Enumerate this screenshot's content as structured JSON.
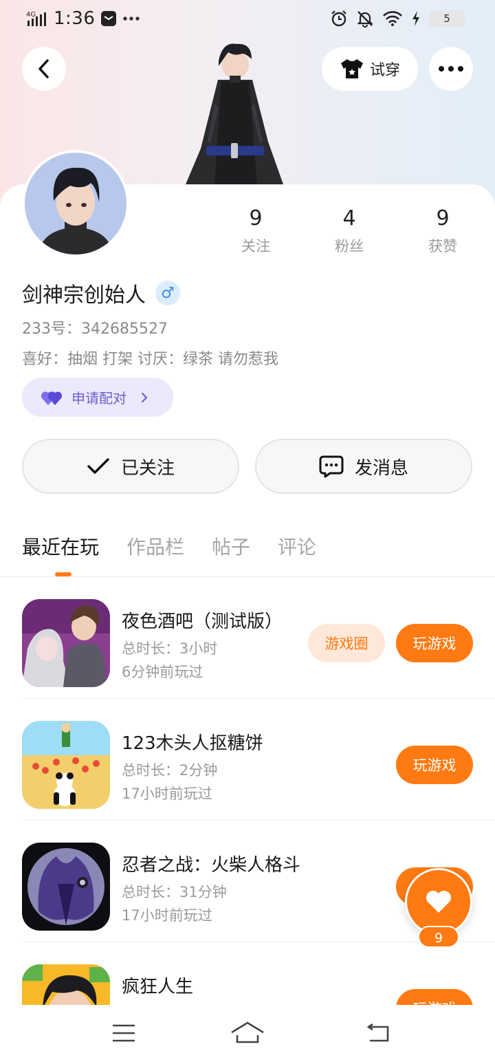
{
  "status_bar": {
    "network": "4G",
    "time": "1:36",
    "battery": "5"
  },
  "header": {
    "tryon_label": "试穿"
  },
  "profile": {
    "name": "剑神宗创始人",
    "gender_symbol": "♂",
    "id_text": "233号：342685527",
    "hobbies_text": "喜好：抽烟  打架  讨厌：绿茶  请勿惹我",
    "pair_label": "申请配对"
  },
  "stats": [
    {
      "value": "9",
      "label": "关注"
    },
    {
      "value": "4",
      "label": "粉丝"
    },
    {
      "value": "9",
      "label": "获赞"
    }
  ],
  "actions": {
    "follow_label": "已关注",
    "message_label": "发消息"
  },
  "tabs": [
    {
      "label": "最近在玩",
      "active": true
    },
    {
      "label": "作品栏",
      "active": false
    },
    {
      "label": "帖子",
      "active": false
    },
    {
      "label": "评论",
      "active": false
    }
  ],
  "games": [
    {
      "title": "夜色酒吧（测试版）",
      "duration": "总时长：3小时",
      "last_played": "6分钟前玩过",
      "circle_label": "游戏圈",
      "play_label": "玩游戏"
    },
    {
      "title": "123木头人抠糖饼",
      "duration": "总时长：2分钟",
      "last_played": "17小时前玩过",
      "play_label": "玩游戏"
    },
    {
      "title": "忍者之战：火柴人格斗",
      "duration": "总时长：31分钟",
      "last_played": "17小时前玩过",
      "play_label": "玩游戏"
    },
    {
      "title": "疯狂人生",
      "duration": "",
      "last_played": "",
      "play_label": "玩游戏"
    }
  ],
  "floating_like": {
    "count": "9"
  },
  "colors": {
    "accent_orange": "#ff7a12",
    "pair_purple": "#6c5fd1",
    "gender_blue": "#3b8fe0"
  },
  "icons": [
    "signal-icon",
    "message-notification-icon",
    "more-dots-icon",
    "alarm-icon",
    "bell-off-icon",
    "wifi-icon",
    "charging-icon",
    "back-arrow-icon",
    "tshirt-icon",
    "heart-icon",
    "chevron-right-icon",
    "checkmark-icon",
    "chat-bubble-icon",
    "menu-icon",
    "home-icon",
    "return-icon"
  ]
}
